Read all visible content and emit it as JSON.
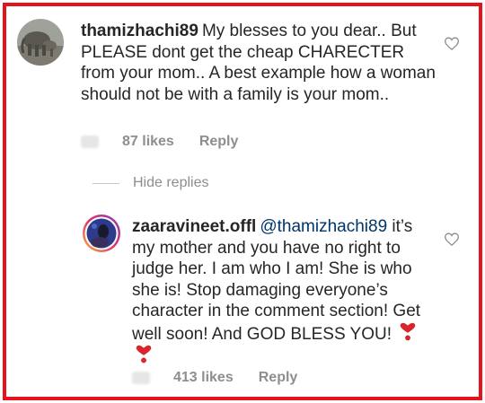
{
  "comments": [
    {
      "username": "thamizhachi89",
      "text": "My blesses to you dear.. But PLEASE dont get the cheap CHARECTER from your mom.. A best example how a woman should not be with a family is your mom..",
      "likes": "87 likes",
      "reply_label": "Reply"
    }
  ],
  "hide_replies_label": "Hide replies",
  "replies": [
    {
      "username": "zaaravineet.offl",
      "mention": "@thamizhachi89",
      "text": "it’s my mother and you have no right to judge her. I am who I am! She is who she is! Stop damaging everyone’s character in the comment section! Get well soon! And GOD BLESS YOU!",
      "emoji": [
        "heavy-heart-exclamation",
        "heavy-heart-exclamation"
      ],
      "likes": "413 likes",
      "reply_label": "Reply"
    }
  ],
  "colors": {
    "border": "#e3141b",
    "text": "#262626",
    "secondary": "#8e8e8e",
    "mention": "#003569",
    "heart_emoji": "#d8262d"
  }
}
